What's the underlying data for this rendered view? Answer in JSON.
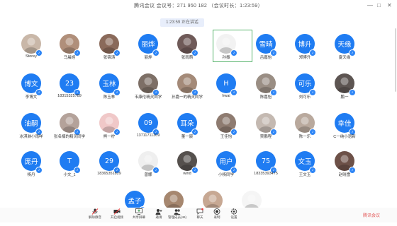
{
  "window": {
    "title": "腾讯会议 会议号：271 950 182  （会议时长：1:23:59）",
    "timer": "1:23:59  正在讲话",
    "controls": [
      "—",
      "□",
      "✕"
    ]
  },
  "participants": [
    {
      "name": "Storey",
      "avatar_text": "",
      "kind": "img",
      "tone": "#c9b7a8"
    },
    {
      "name": "马晨旭",
      "avatar_text": "",
      "kind": "img",
      "tone": "#b08f7a"
    },
    {
      "name": "张锦涛",
      "avatar_text": "",
      "kind": "img",
      "tone": "#8a6a5a"
    },
    {
      "name": "丽烨",
      "avatar_text": "丽烨",
      "kind": "blue"
    },
    {
      "name": "张雨萌",
      "avatar_text": "",
      "kind": "img",
      "tone": "#6f5a58"
    },
    {
      "name": "孙振",
      "avatar_text": "",
      "kind": "img",
      "tone": "#f2f2f2"
    },
    {
      "name": "吕嘉怡",
      "avatar_text": "雪晴",
      "kind": "blue"
    },
    {
      "name": "郑博升",
      "avatar_text": "博升",
      "kind": "blue"
    },
    {
      "name": "夏天缘",
      "avatar_text": "天缘",
      "kind": "blue"
    },
    {
      "name": "李博文",
      "avatar_text": "博文",
      "kind": "blue"
    },
    {
      "name": "18315325789",
      "avatar_text": "23",
      "kind": "blue"
    },
    {
      "name": "陈玉林",
      "avatar_text": "玉林",
      "kind": "blue"
    },
    {
      "name": "韦康伦精灵同学",
      "avatar_text": "",
      "kind": "img",
      "tone": "#7d6f66"
    },
    {
      "name": "孙嘉一的精灵同学",
      "avatar_text": "",
      "kind": "img",
      "tone": "#a48a78"
    },
    {
      "name": "hwai",
      "avatar_text": "H",
      "kind": "blue"
    },
    {
      "name": "陈嘉怡",
      "avatar_text": "",
      "kind": "img",
      "tone": "#9a8e84"
    },
    {
      "name": "刘可乐",
      "avatar_text": "可乐",
      "kind": "blue"
    },
    {
      "name": "鹏一",
      "avatar_text": "",
      "kind": "img",
      "tone": "#5d5552"
    },
    {
      "name": "冰淇淋小雨咩",
      "avatar_text": "油嗣",
      "kind": "blue"
    },
    {
      "name": "张名楠的精灵同学",
      "avatar_text": "",
      "kind": "img",
      "tone": "#b4a29a"
    },
    {
      "name": "熊一柠",
      "avatar_text": "",
      "kind": "img",
      "tone": "#f0c8c8"
    },
    {
      "name": "13711711309",
      "avatar_text": "09",
      "kind": "blue"
    },
    {
      "name": "董一宸",
      "avatar_text": "耳朵",
      "kind": "blue"
    },
    {
      "name": "王佳怡",
      "avatar_text": "",
      "kind": "img",
      "tone": "#8e7b70"
    },
    {
      "name": "贾鹏程",
      "avatar_text": "",
      "kind": "img",
      "tone": "#c4b9b1"
    },
    {
      "name": "陈一乐",
      "avatar_text": "",
      "kind": "img",
      "tone": "#b9a99d"
    },
    {
      "name": "C一纯小语新",
      "avatar_text": "幸佳",
      "kind": "blue"
    },
    {
      "name": "杨丹",
      "avatar_text": "庞丹",
      "kind": "blue"
    },
    {
      "name": "小文_1",
      "avatar_text": "T",
      "kind": "blue"
    },
    {
      "name": "18365351829",
      "avatar_text": "29",
      "kind": "blue"
    },
    {
      "name": "曾娜",
      "avatar_text": "",
      "kind": "img",
      "tone": "#efefef"
    },
    {
      "name": "wind",
      "avatar_text": "",
      "kind": "img",
      "tone": "#55504d"
    },
    {
      "name": "小杨同学",
      "avatar_text": "用户",
      "kind": "blue"
    },
    {
      "name": "18335393475",
      "avatar_text": "75",
      "kind": "blue"
    },
    {
      "name": "王文玉",
      "avatar_text": "文玉",
      "kind": "blue"
    },
    {
      "name": "赵晓雪",
      "avatar_text": "",
      "kind": "img",
      "tone": "#6d5148"
    },
    {
      "name": "",
      "avatar_text": "孟子",
      "kind": "blue"
    },
    {
      "name": "",
      "avatar_text": "",
      "kind": "img",
      "tone": "#a6876f"
    },
    {
      "name": "",
      "avatar_text": "",
      "kind": "img",
      "tone": "#c7a893"
    },
    {
      "name": "",
      "avatar_text": "",
      "kind": "img",
      "tone": "#f5f5f5"
    }
  ],
  "toolbar": {
    "items": [
      {
        "label": "解除静音",
        "icon": "mic-off-icon"
      },
      {
        "label": "开启视频",
        "icon": "video-off-icon"
      },
      {
        "label": "共享屏幕",
        "icon": "screen-share-icon"
      },
      {
        "label": "邀请",
        "icon": "invite-icon"
      },
      {
        "label": "管理成员(46)",
        "icon": "members-icon"
      },
      {
        "label": "聊天",
        "icon": "chat-icon"
      },
      {
        "label": "录制",
        "icon": "record-icon"
      },
      {
        "label": "设置",
        "icon": "settings-icon"
      }
    ]
  },
  "watermark": "腾讯会议"
}
